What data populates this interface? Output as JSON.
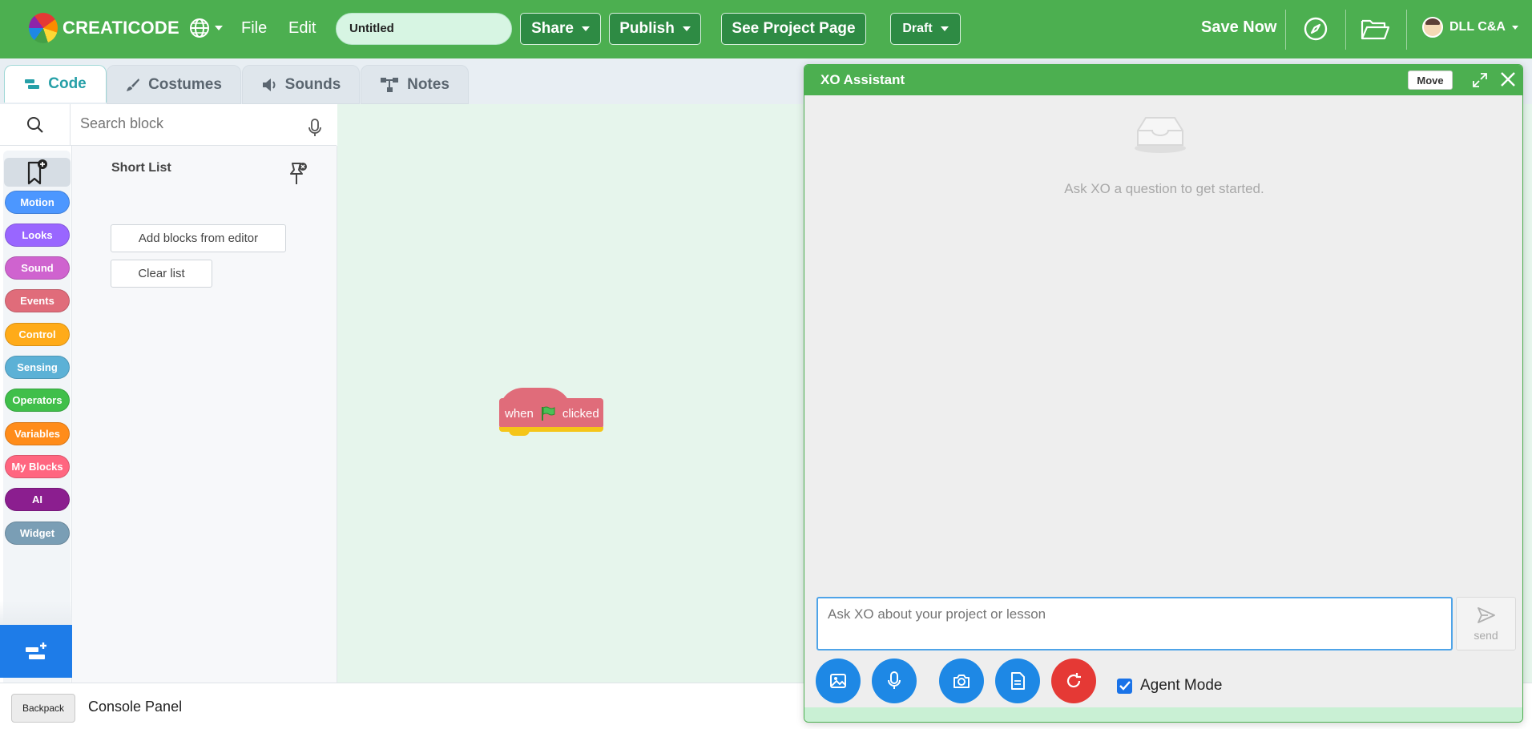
{
  "app": {
    "logo_text": "CREATICODE",
    "menu": {
      "file": "File",
      "edit": "Edit"
    },
    "project_title": "Untitled",
    "buttons": {
      "share": "Share",
      "publish": "Publish",
      "see_project_page": "See Project Page",
      "draft": "Draft",
      "save_now": "Save Now"
    },
    "user_name": "DLL C&A",
    "colors": {
      "brand_green": "#4caf50",
      "workspace_bg": "#e6f5ec",
      "accent_blue": "#1e88e5"
    }
  },
  "tabs": [
    {
      "label": "Code",
      "icon": "code-icon",
      "active": true
    },
    {
      "label": "Costumes",
      "icon": "brush-icon",
      "active": false
    },
    {
      "label": "Sounds",
      "icon": "speaker-icon",
      "active": false
    },
    {
      "label": "Notes",
      "icon": "notes-icon",
      "active": false
    }
  ],
  "palette": {
    "search_placeholder": "Search block",
    "categories": [
      {
        "label": "Motion",
        "color": "#4c97ff"
      },
      {
        "label": "Looks",
        "color": "#9966ff"
      },
      {
        "label": "Sound",
        "color": "#cf63cf"
      },
      {
        "label": "Events",
        "color": "#e06c7a"
      },
      {
        "label": "Control",
        "color": "#ffab19"
      },
      {
        "label": "Sensing",
        "color": "#5cb1d6"
      },
      {
        "label": "Operators",
        "color": "#40bf4a"
      },
      {
        "label": "Variables",
        "color": "#ff8c1a"
      },
      {
        "label": "My Blocks",
        "color": "#ff6680"
      },
      {
        "label": "AI",
        "color": "#8b1e8f"
      },
      {
        "label": "Widget",
        "color": "#7a9eb5"
      }
    ],
    "short_list": {
      "title": "Short List",
      "add_blocks": "Add blocks from editor",
      "clear_list": "Clear list"
    }
  },
  "workspace": {
    "hat_block": {
      "prefix": "when",
      "suffix": "clicked"
    }
  },
  "console": {
    "backpack": "Backpack",
    "label": "Console Panel"
  },
  "xo": {
    "title": "XO Assistant",
    "move": "Move",
    "empty_message": "Ask XO a question to get started.",
    "input_placeholder": "Ask XO about your project or lesson",
    "send": "send",
    "agent_mode": "Agent Mode",
    "agent_mode_checked": true
  }
}
